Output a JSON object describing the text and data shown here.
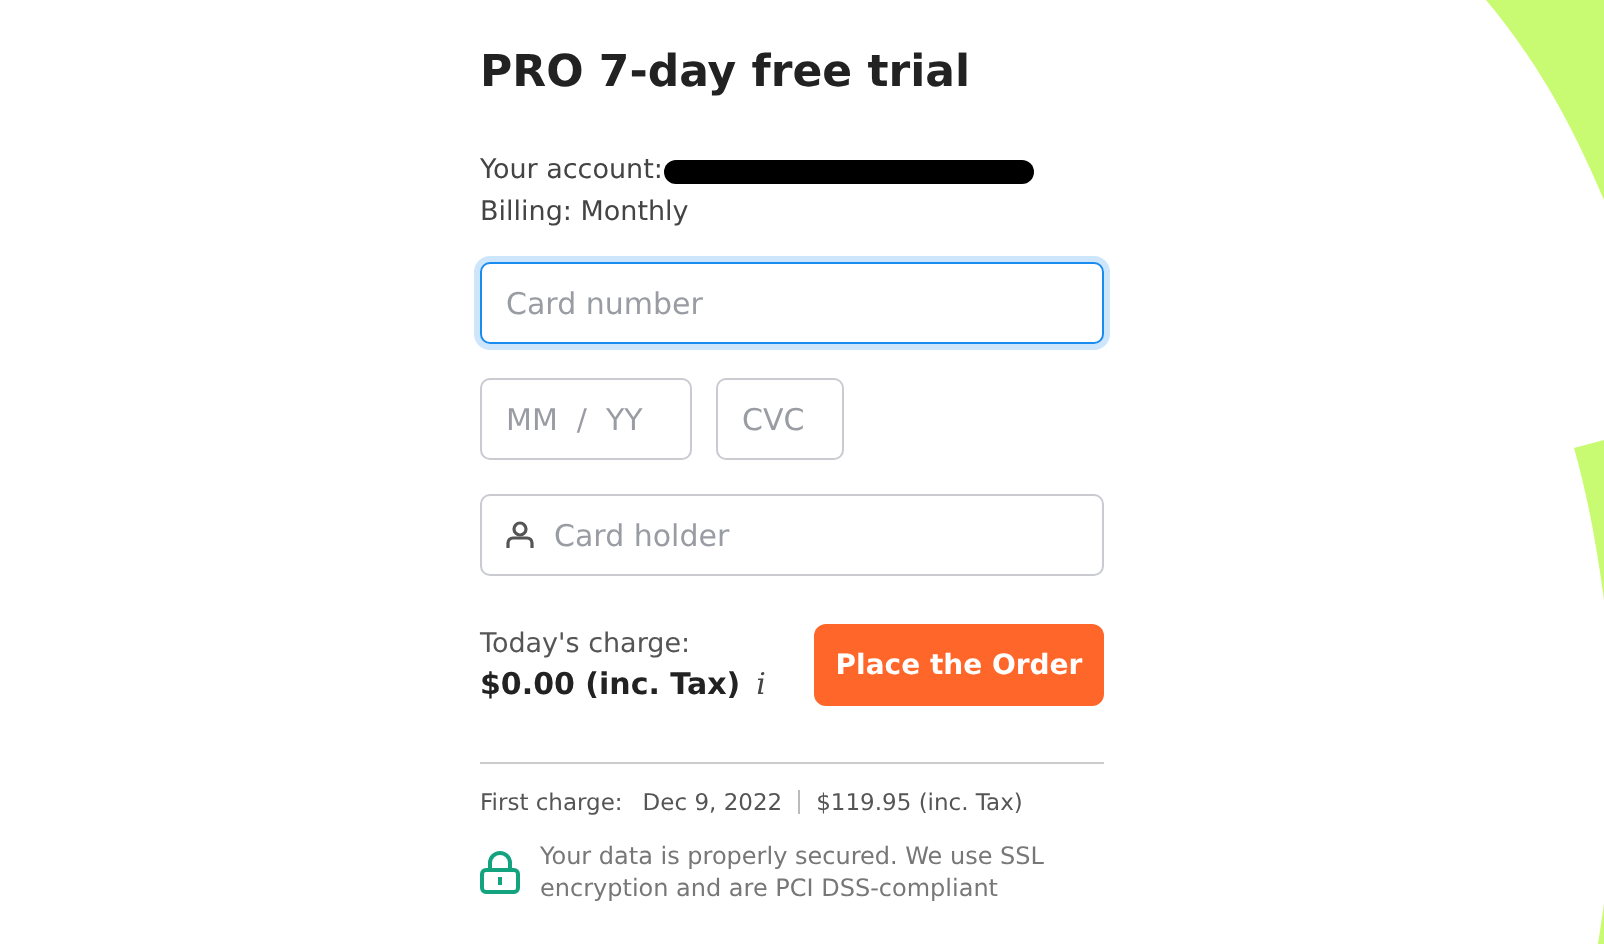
{
  "title": "PRO 7-day free trial",
  "account": {
    "label": "Your account:",
    "redacted": true
  },
  "billing": "Billing: Monthly",
  "fields": [
    {
      "kind": "card",
      "placeholder": "Card number",
      "focused": true
    },
    {
      "kind": "expiry",
      "placeholder": "MM  /  YY",
      "focused": false
    },
    {
      "kind": "cvc",
      "placeholder": "CVC",
      "focused": false
    },
    {
      "kind": "holder",
      "placeholder": "Card holder",
      "focused": false
    }
  ],
  "charge": {
    "label": "Today's charge:",
    "amount": "$0.00 (inc. Tax)",
    "info": "i"
  },
  "order_button": "Place the Order",
  "first_charge": {
    "label": "First charge:",
    "date": "Dec 9, 2022",
    "amount": "$119.95 (inc. Tax)"
  },
  "security_note": "Your data is properly secured. We use SSL encryption and are PCI DSS-compliant"
}
